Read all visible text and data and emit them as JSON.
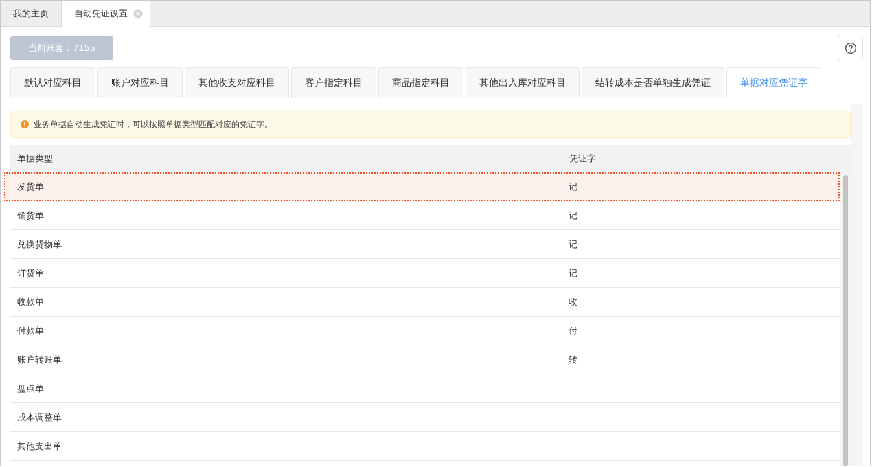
{
  "page_tabs": [
    {
      "label": "我的主页",
      "selected": false,
      "closable": false
    },
    {
      "label": "自动凭证设置",
      "selected": true,
      "closable": true
    }
  ],
  "account_button": "当前账套：7155",
  "setting_tabs": [
    {
      "label": "默认对应科目",
      "selected": false
    },
    {
      "label": "账户对应科目",
      "selected": false
    },
    {
      "label": "其他收支对应科目",
      "selected": false
    },
    {
      "label": "客户指定科目",
      "selected": false
    },
    {
      "label": "商品指定科目",
      "selected": false
    },
    {
      "label": "其他出入库对应科目",
      "selected": false
    },
    {
      "label": "结转成本是否单独生成凭证",
      "selected": false
    },
    {
      "label": "单据对应凭证字",
      "selected": true
    }
  ],
  "notice": "业务单据自动生成凭证时，可以按照单据类型匹配对应的凭证字。",
  "table": {
    "columns": [
      "单据类型",
      "凭证字"
    ],
    "rows": [
      {
        "cells": [
          "发货单",
          "记"
        ],
        "selected": true
      },
      {
        "cells": [
          "销货单",
          "记"
        ],
        "selected": false
      },
      {
        "cells": [
          "兑换货物单",
          "记"
        ],
        "selected": false
      },
      {
        "cells": [
          "订货单",
          "记"
        ],
        "selected": false
      },
      {
        "cells": [
          "收款单",
          "收"
        ],
        "selected": false
      },
      {
        "cells": [
          "付款单",
          "付"
        ],
        "selected": false
      },
      {
        "cells": [
          "账户转账单",
          "转"
        ],
        "selected": false
      },
      {
        "cells": [
          "盘点单"
        ],
        "selected": false
      },
      {
        "cells": [
          "成本调整单"
        ],
        "selected": false
      },
      {
        "cells": [
          "其他支出单"
        ],
        "selected": false
      }
    ]
  }
}
